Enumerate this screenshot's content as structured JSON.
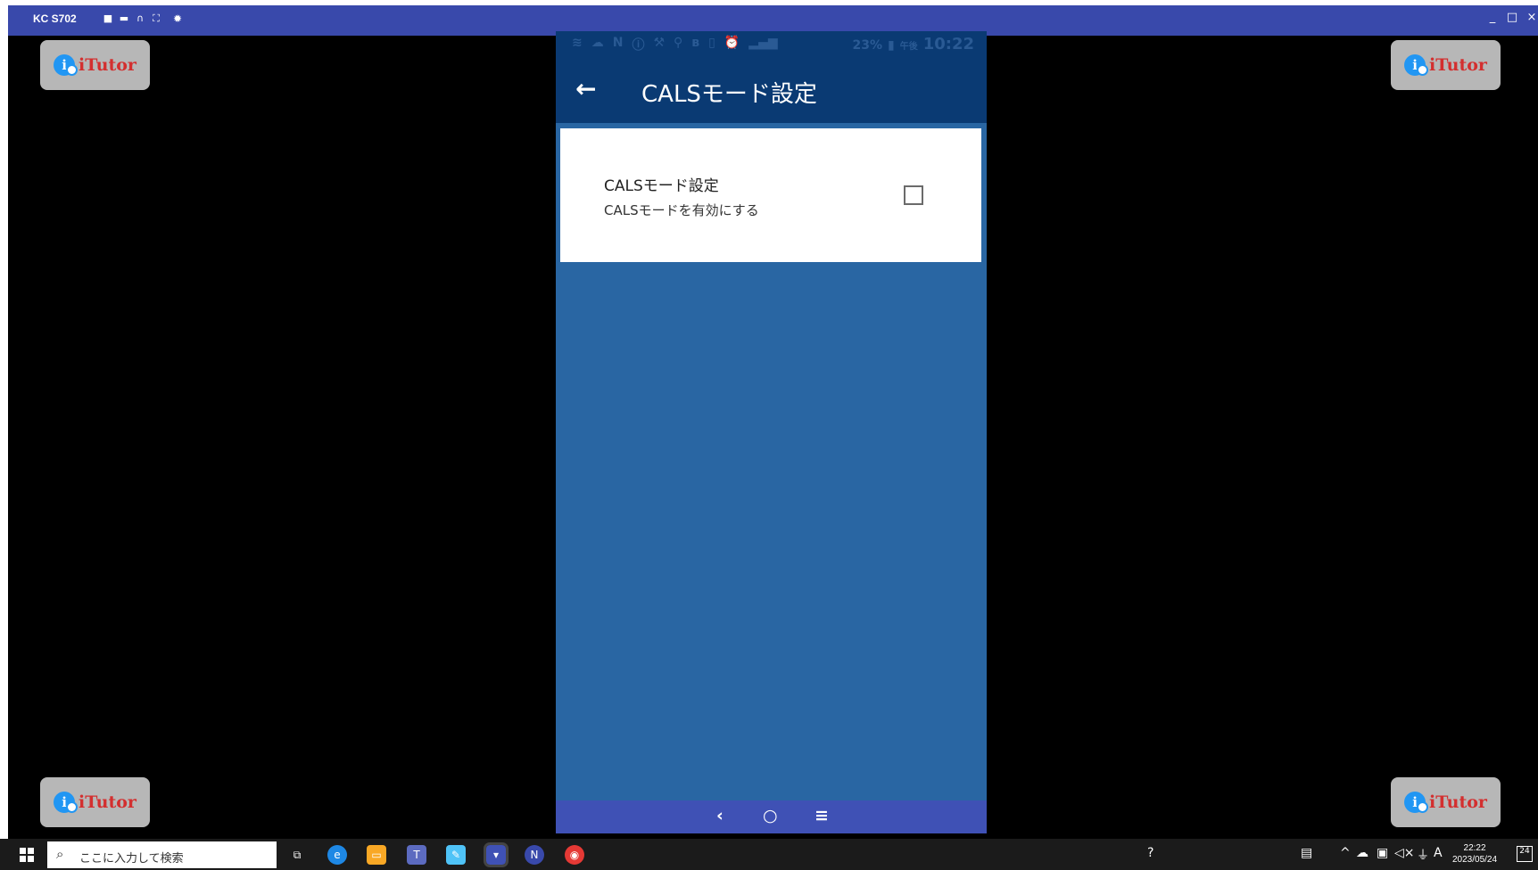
{
  "window": {
    "title": "KC S702",
    "toolbar_icons": [
      "camera-icon",
      "video-icon",
      "headphones-icon",
      "fullscreen-icon",
      "gear-icon"
    ],
    "controls": [
      "_",
      "□",
      "×"
    ]
  },
  "badges": {
    "text": "iTutor",
    "logo": "i"
  },
  "phone": {
    "status": {
      "battery": "23%",
      "period": "午後",
      "time": "10:22"
    },
    "appbar": {
      "title": "CALSモード設定"
    },
    "preference": {
      "title": "CALSモード設定",
      "summary": "CALSモードを有効にする",
      "checked": false
    },
    "nav": {
      "back": "‹",
      "home": "○",
      "recents": "≡"
    }
  },
  "taskbar": {
    "search_placeholder": "ここに入力して検索",
    "apps": [
      "task-view",
      "edge",
      "file-explorer",
      "teams",
      "notepad",
      "mirror-app",
      "n-app",
      "chrome"
    ],
    "clock_time": "22:22",
    "clock_date": "2023/05/24",
    "ime": "A",
    "notify_count": "24"
  },
  "colors": {
    "titlebar": "#3949ab",
    "appbar": "#0a3a73",
    "screen_bg": "#2966a3",
    "navbar": "#3f51b5",
    "badge_text": "#d32f2f"
  }
}
